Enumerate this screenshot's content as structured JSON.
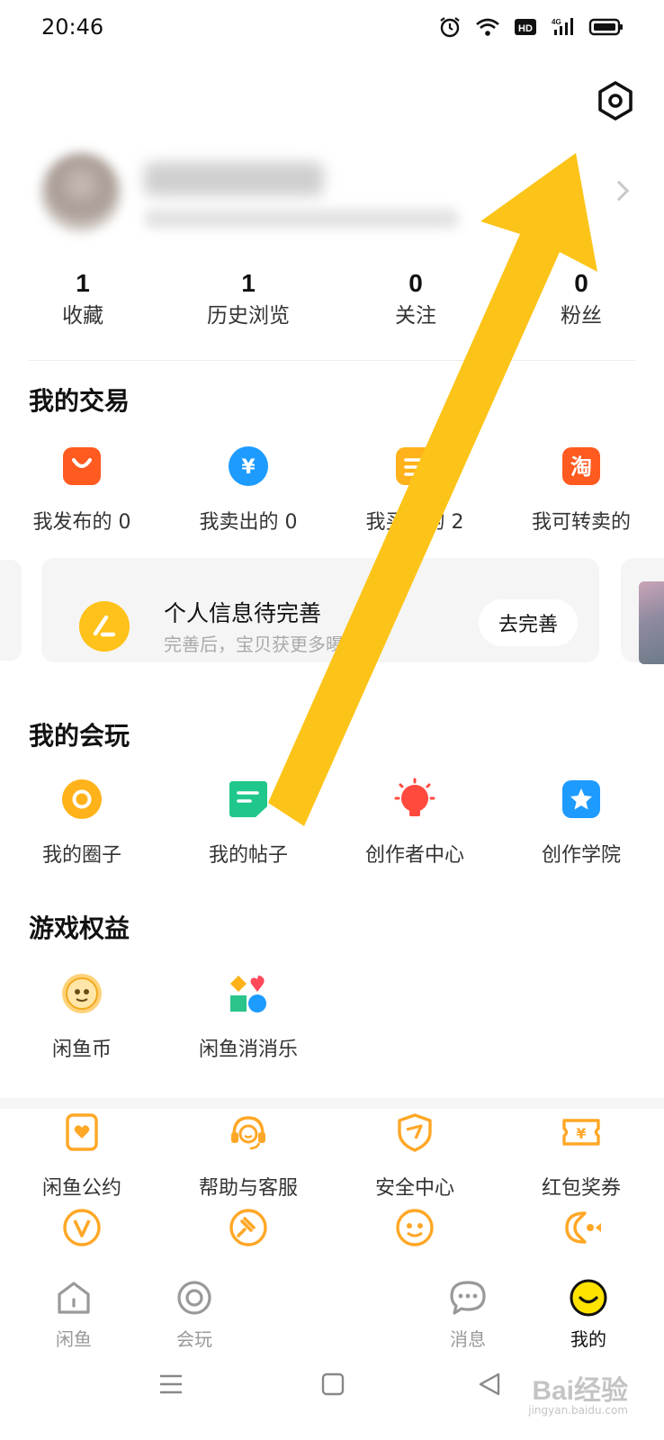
{
  "status_bar": {
    "time": "20:46",
    "icons": [
      "alarm-icon",
      "wifi-icon",
      "hd-icon",
      "signal-4g-icon",
      "battery-icon"
    ]
  },
  "header": {
    "settings_icon": "settings-hex-icon"
  },
  "profile": {
    "chevron_icon": "chevron-right-icon"
  },
  "stats": [
    {
      "value": "1",
      "label": "收藏"
    },
    {
      "value": "1",
      "label": "历史浏览"
    },
    {
      "value": "0",
      "label": "关注"
    },
    {
      "value": "0",
      "label": "粉丝"
    }
  ],
  "trade": {
    "title": "我的交易",
    "items": [
      {
        "label": "我发布的 0",
        "icon": "shopping-bag-icon",
        "color": "#ff5a1f"
      },
      {
        "label": "我卖出的 0",
        "icon": "yen-coin-icon",
        "color": "#1e9bff"
      },
      {
        "label": "我买到的 2",
        "icon": "order-list-icon",
        "color": "#ffb21a"
      },
      {
        "label": "我可转卖的",
        "icon": "taobao-icon",
        "color": "#ff5a1f"
      }
    ]
  },
  "profile_card": {
    "title": "个人信息待完善",
    "subtitle": "完善后，宝贝获更多曝光",
    "button": "去完善",
    "icon": "pencil-icon"
  },
  "play": {
    "title": "我的会玩",
    "items": [
      {
        "label": "我的圈子",
        "icon": "circle-icon",
        "color": "#ffb21a"
      },
      {
        "label": "我的帖子",
        "icon": "post-icon",
        "color": "#1fc78a"
      },
      {
        "label": "创作者中心",
        "icon": "bulb-icon",
        "color": "#ff4a3d"
      },
      {
        "label": "创作学院",
        "icon": "star-icon",
        "color": "#1e9bff"
      }
    ]
  },
  "games": {
    "title": "游戏权益",
    "items": [
      {
        "label": "闲鱼币",
        "icon": "fish-coin-icon"
      },
      {
        "label": "闲鱼消消乐",
        "icon": "hearts-game-icon"
      }
    ]
  },
  "services": {
    "items": [
      {
        "label": "闲鱼公约",
        "icon": "heart-doc-icon"
      },
      {
        "label": "帮助与客服",
        "icon": "headset-icon"
      },
      {
        "label": "安全中心",
        "icon": "shield-icon"
      },
      {
        "label": "红包奖券",
        "icon": "coupon-icon"
      }
    ],
    "row2_icons": [
      "v-badge-icon",
      "gavel-icon",
      "monkey-icon",
      "fish-icon"
    ]
  },
  "tabbar": [
    {
      "label": "闲鱼",
      "icon": "home-icon",
      "active": false
    },
    {
      "label": "会玩",
      "icon": "ring-icon",
      "active": false
    },
    {
      "label": "消息",
      "icon": "chat-icon",
      "active": false
    },
    {
      "label": "我的",
      "icon": "smile-face-icon",
      "active": true
    }
  ],
  "navbar": {
    "icons": [
      "menu-icon",
      "home-square-icon",
      "back-icon"
    ]
  },
  "annotation": {
    "arrow_color": "#fcc419"
  },
  "watermark": {
    "text": "Bai经验",
    "sub": "jingyan.baidu.com"
  }
}
